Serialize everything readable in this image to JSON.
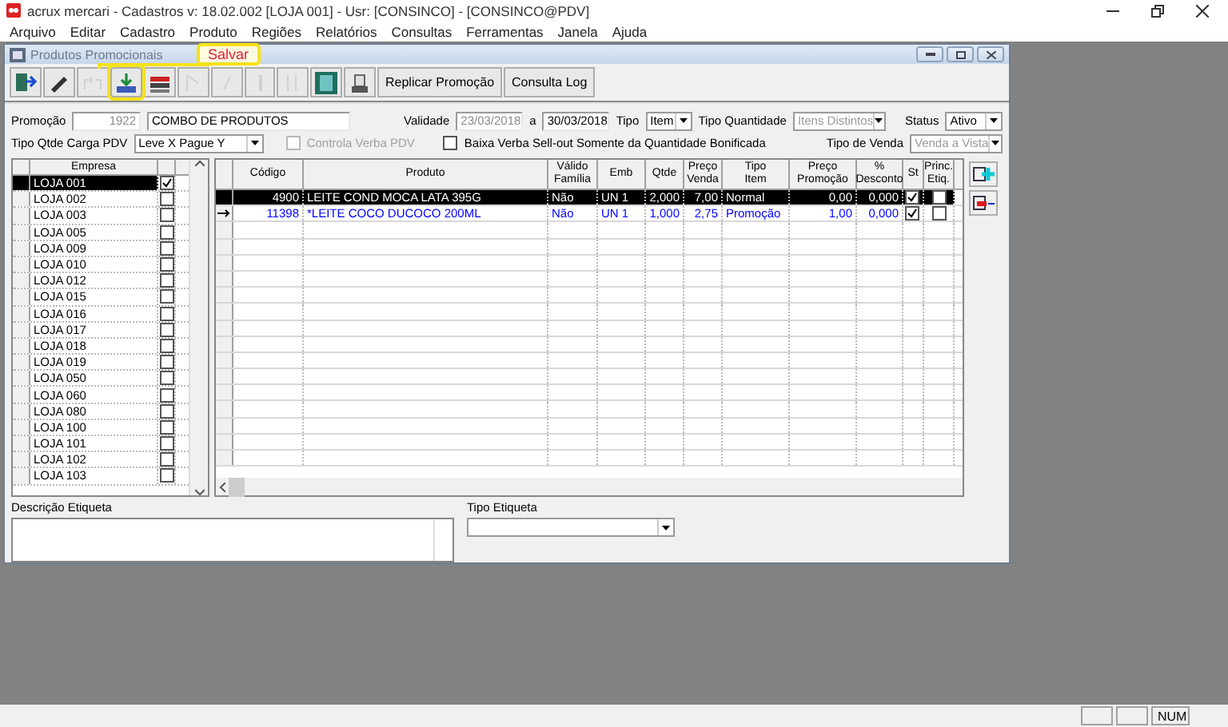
{
  "app": {
    "title": "acrux mercari - Cadastros  v: 18.02.002  [LOJA 001] - Usr: [CONSINCO] - [CONSINCO@PDV]"
  },
  "menu": [
    "Arquivo",
    "Editar",
    "Cadastro",
    "Produto",
    "Regiões",
    "Relatórios",
    "Consultas",
    "Ferramentas",
    "Janela",
    "Ajuda"
  ],
  "window": {
    "title": "Produtos Promocionais"
  },
  "callout": {
    "label": "Salvar"
  },
  "toolbar": [
    {
      "kind": "icon",
      "disabled": false,
      "highlighted": false
    },
    {
      "kind": "icon",
      "disabled": false,
      "highlighted": false
    },
    {
      "kind": "icon",
      "disabled": true,
      "highlighted": false
    },
    {
      "kind": "icon",
      "disabled": false,
      "highlighted": true
    },
    {
      "kind": "icon",
      "disabled": false,
      "highlighted": false
    },
    {
      "kind": "icon",
      "disabled": true,
      "highlighted": false
    },
    {
      "kind": "icon",
      "disabled": true,
      "highlighted": false
    },
    {
      "kind": "icon",
      "disabled": true,
      "highlighted": false
    },
    {
      "kind": "icon",
      "disabled": true,
      "highlighted": false
    },
    {
      "kind": "icon",
      "disabled": false,
      "highlighted": false
    },
    {
      "kind": "icon",
      "disabled": false,
      "highlighted": false
    },
    {
      "kind": "text",
      "label": "Replicar Promoção",
      "disabled": false,
      "highlighted": false
    },
    {
      "kind": "text",
      "label": "Consulta Log",
      "disabled": false,
      "highlighted": false
    }
  ],
  "form": {
    "promo_label": "Promoção",
    "promo_code": "1922",
    "promo_name": "COMBO DE PRODUTOS",
    "validity_label": "Validade",
    "validity_from": "23/03/2018",
    "validity_sep": "a",
    "validity_to": "30/03/2018",
    "type_label": "Tipo",
    "type_value": "Item",
    "qty_type_label": "Tipo Quantidade",
    "qty_type_value": "Itens Distintos",
    "status_label": "Status",
    "status_value": "Ativo",
    "load_type_label": "Tipo Qtde Carga PDV",
    "load_type_value": "Leve X Pague Y",
    "checkboxes": [
      {
        "label": "Controla Verba PDV",
        "checked": false,
        "disabled": true
      },
      {
        "label": "Baixa Verba Sell-out Somente da Quantidade Bonificada",
        "checked": false,
        "disabled": false
      }
    ],
    "sale_type_label": "Tipo de Venda",
    "sale_type_value": "Venda a Vista"
  },
  "stores": {
    "column": "Empresa",
    "rows": [
      {
        "name": "LOJA 001",
        "selected": true,
        "checked": true
      },
      {
        "name": "LOJA 002",
        "selected": false,
        "checked": false
      },
      {
        "name": "LOJA 003",
        "selected": false,
        "checked": false
      },
      {
        "name": "LOJA 005",
        "selected": false,
        "checked": false
      },
      {
        "name": "LOJA 009",
        "selected": false,
        "checked": false
      },
      {
        "name": "LOJA 010",
        "selected": false,
        "checked": false
      },
      {
        "name": "LOJA 012",
        "selected": false,
        "checked": false
      },
      {
        "name": "LOJA 015",
        "selected": false,
        "checked": false
      },
      {
        "name": "LOJA 016",
        "selected": false,
        "checked": false
      },
      {
        "name": "LOJA 017",
        "selected": false,
        "checked": false
      },
      {
        "name": "LOJA 018",
        "selected": false,
        "checked": false
      },
      {
        "name": "LOJA 019",
        "selected": false,
        "checked": false
      },
      {
        "name": "LOJA 050",
        "selected": false,
        "checked": false
      },
      {
        "name": "LOJA 060",
        "selected": false,
        "checked": false
      },
      {
        "name": "LOJA 080",
        "selected": false,
        "checked": false
      },
      {
        "name": "LOJA 100",
        "selected": false,
        "checked": false
      },
      {
        "name": "LOJA 101",
        "selected": false,
        "checked": false
      },
      {
        "name": "LOJA 102",
        "selected": false,
        "checked": false
      },
      {
        "name": "LOJA 103",
        "selected": false,
        "checked": false
      }
    ]
  },
  "products": {
    "columns": [
      "Código",
      "Produto",
      "Válido\nFamília",
      "Emb",
      "Qtde",
      "Preço\nVenda",
      "Tipo\nItem",
      "Preço\nPromoção",
      "%\nDesconto",
      "St",
      "Princ.\nEtiq."
    ],
    "rows": [
      {
        "cells": [
          "4900",
          "LEITE COND MOCA LATA 395G",
          "Não",
          "UN 1",
          "2,000",
          "7,00",
          "Normal",
          "0,00",
          "0,000"
        ],
        "st": true,
        "princ_etiq": false,
        "selected": true,
        "current": false,
        "color": "#000000"
      },
      {
        "cells": [
          "11398",
          "*LEITE COCO DUCOCO 200ML",
          "Não",
          "UN 1",
          "1,000",
          "2,75",
          "Promoção",
          "1,00",
          "0,000"
        ],
        "st": true,
        "princ_etiq": false,
        "selected": false,
        "current": true,
        "color": "#0000ff"
      }
    ]
  },
  "label_description": {
    "label": "Descrição Etiqueta"
  },
  "label_type": {
    "label": "Tipo Etiqueta"
  },
  "status_bar": {
    "num": "NUM"
  }
}
